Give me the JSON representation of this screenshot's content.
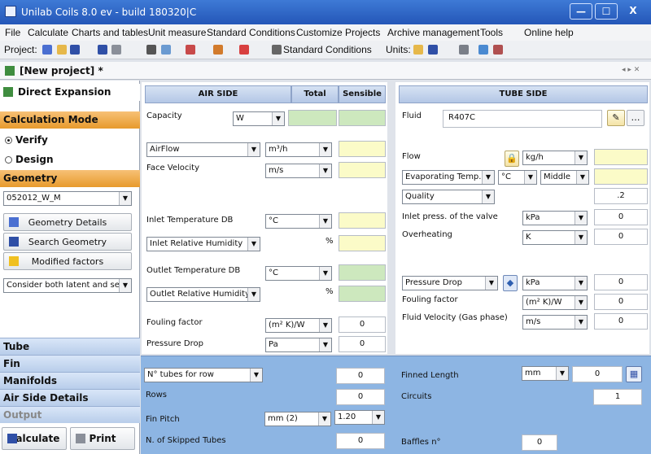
{
  "window": {
    "title": "Unilab Coils 8.0 ev - build 180320|C",
    "minimize": "—",
    "maximize": "☐",
    "close": "X"
  },
  "menu": [
    "File",
    "Calculate",
    "Charts and tables",
    "Unit measure",
    "Standard Conditions",
    "Customize",
    "Projects",
    "Archive management",
    "Tools",
    "Online help"
  ],
  "toolbar": {
    "project_label": "Project:",
    "std_conditions": "Standard Conditions",
    "units_label": "Units:"
  },
  "tab": {
    "label": "[New project] *",
    "nav": "◂ ▸ ✕"
  },
  "left": {
    "mode_title": "Direct Expansion",
    "calc_mode": "Calculation Mode",
    "verify": "Verify",
    "design": "Design",
    "geometry": "Geometry",
    "geometry_value": "052012_W_M",
    "btn_geometry_details": "Geometry Details",
    "btn_search_geometry": "Search Geometry",
    "btn_modified_factors": "Modified factors",
    "consider": "Consider both latent and se",
    "sections": [
      "Tube",
      "Fin",
      "Manifolds",
      "Air Side Details",
      "Output"
    ],
    "calculate": "Calculate",
    "print": "Print"
  },
  "air": {
    "header": "AIR SIDE",
    "total": "Total",
    "sensible": "Sensible",
    "capacity": "Capacity",
    "capacity_unit": "W",
    "airflow": "AirFlow",
    "airflow_unit": "m³/h",
    "face_velocity": "Face Velocity",
    "face_velocity_unit": "m/s",
    "inlet_temp": "Inlet Temperature DB",
    "inlet_temp_unit": "°C",
    "inlet_rh": "Inlet Relative Humidity",
    "percent": "%",
    "outlet_temp": "Outlet Temperature DB",
    "outlet_temp_unit": "°C",
    "outlet_rh": "Outlet Relative Humidity",
    "fouling": "Fouling factor",
    "fouling_unit": "(m² K)/W",
    "fouling_value": "0",
    "pdrop": "Pressure Drop",
    "pdrop_unit": "Pa",
    "pdrop_value": "0"
  },
  "tube": {
    "header": "TUBE SIDE",
    "fluid": "Fluid",
    "fluid_value": "R407C",
    "flow": "Flow",
    "flow_unit": "kg/h",
    "evap": "Evaporating Temp.",
    "evap_unit": "°C",
    "evap_pos": "Middle",
    "quality": "Quality",
    "quality_value": ".2",
    "inlet_press": "Inlet press. of the valve",
    "inlet_press_unit": "kPa",
    "inlet_press_value": "0",
    "overheat": "Overheating",
    "overheat_unit": "K",
    "overheat_value": "0",
    "pdrop": "Pressure Drop",
    "pdrop_unit": "kPa",
    "pdrop_value": "0",
    "fouling": "Fouling factor",
    "fouling_unit": "(m² K)/W",
    "fouling_value": "0",
    "velocity": "Fluid Velocity (Gas phase)",
    "velocity_unit": "m/s",
    "velocity_value": "0"
  },
  "geom": {
    "tubes_row": "N° tubes for row",
    "tubes_row_value": "0",
    "rows": "Rows",
    "rows_value": "0",
    "fin_pitch": "Fin Pitch",
    "fin_pitch_unit": "mm (2)",
    "fin_pitch_value": "1.20",
    "skipped": "N. of Skipped Tubes",
    "skipped_value": "0",
    "finned_length": "Finned Length",
    "finned_length_unit": "mm",
    "finned_length_value": "0",
    "circuits": "Circuits",
    "circuits_value": "1",
    "baffles": "Baffles n°",
    "baffles_value": "0"
  }
}
